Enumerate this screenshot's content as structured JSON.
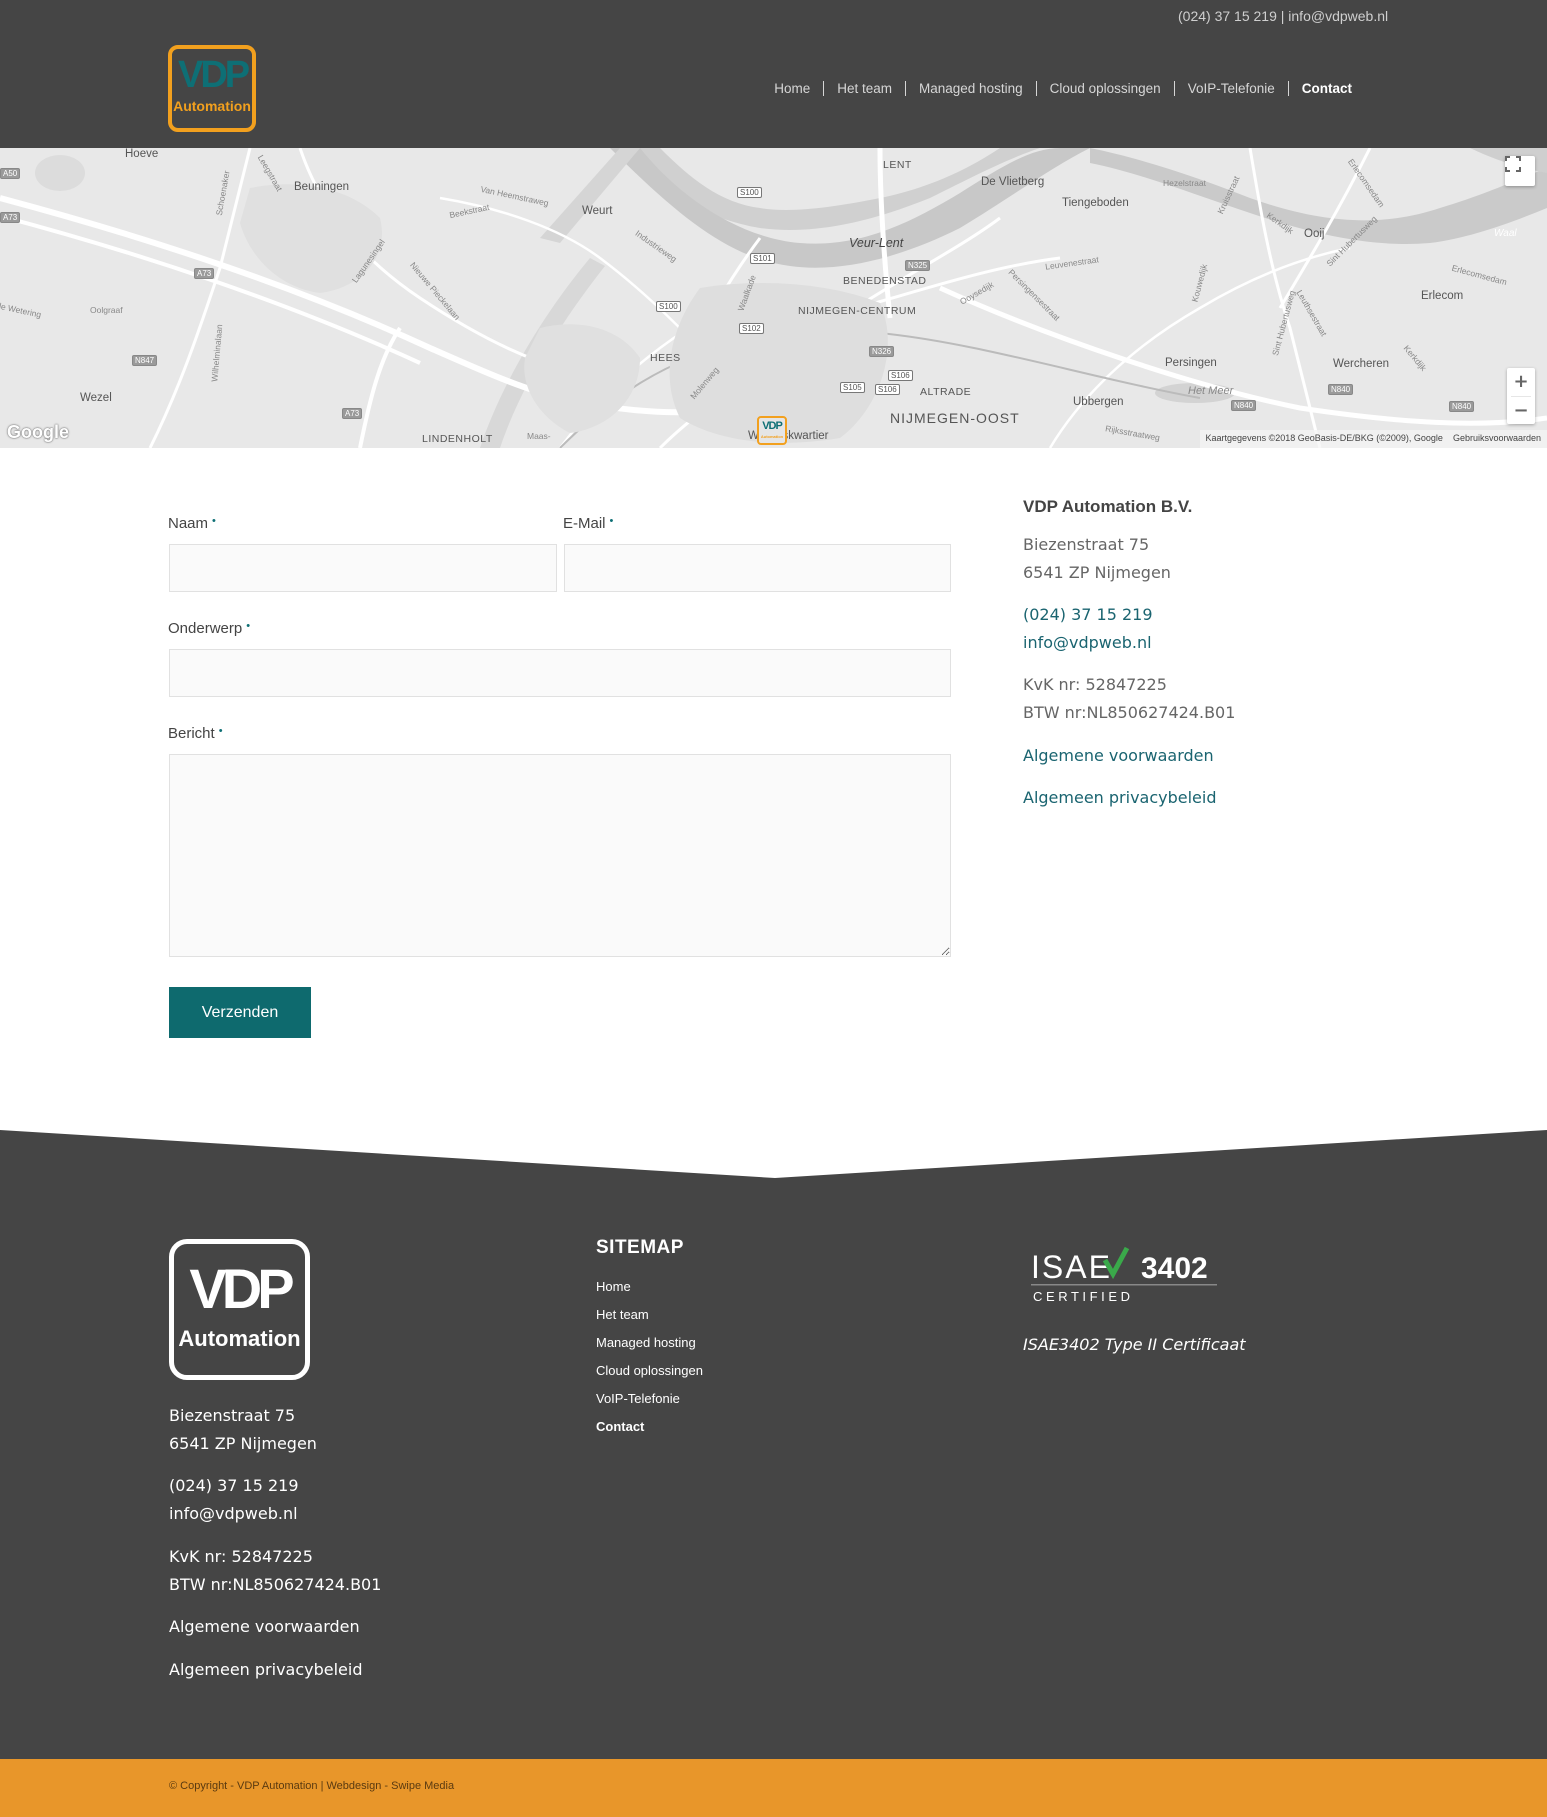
{
  "topbar": {
    "phone": "(024) 37 15 219",
    "separator": "|",
    "email": "info@vdpweb.nl"
  },
  "logo": {
    "mark": "VDP",
    "sub": "Automation"
  },
  "nav": [
    {
      "label": "Home"
    },
    {
      "label": "Het team"
    },
    {
      "label": "Managed hosting"
    },
    {
      "label": "Cloud oplossingen"
    },
    {
      "label": "VoIP-Telefonie"
    },
    {
      "label": "Contact",
      "active": true
    }
  ],
  "map": {
    "places": {
      "hoeve": "Hoeve",
      "beuningen": "Beuningen",
      "weurt": "Weurt",
      "lent": "LENT",
      "de_vlietberg": "De Vlietberg",
      "tiengeboden": "Tiengeboden",
      "ooij": "Ooij",
      "erlecom": "Erlecom",
      "veur_lent": "Veur-Lent",
      "benedenstad": "BENEDENSTAD",
      "nijmegen_centrum": "NIJMEGEN-CENTRUM",
      "hees": "HEES",
      "persingen": "Persingen",
      "wercheren": "Wercheren",
      "ubbergen": "Ubbergen",
      "altrade": "ALTRADE",
      "nijmegen_oost": "NIJMEGEN-OOST",
      "wezel": "Wezel",
      "lindenholt": "LINDENHOLT",
      "willemskwartier": "Willemskwartier",
      "het_meer": "Het Meer"
    },
    "roads": {
      "van_heemstraweg": "Van Heemstraweg",
      "industrieweg": "Industrieweg",
      "nieuwe_pieckelaan": "Nieuwe Pieckelaan",
      "lagunesingel": "Lagunesingel",
      "schoenaker": "Schoenaker",
      "leegstraat": "Leegstraat",
      "wilhelminalaan": "Wilhelminalaan",
      "oolgraaf": "Oolgraaf",
      "molenweg": "Molenweg",
      "waalkade": "Waalkade",
      "hezelstraat": "Hezelstraat",
      "kruisstraat": "Kruisstraat",
      "kerkdijk": "Kerkdijk",
      "sint_hubertusweg": "Sint Hubertusweg",
      "erlecomsedam": "Erlecomsedam",
      "leuthsestraat": "Leuthsestraat",
      "rijksstraatweg": "Rijksstraatweg",
      "oude_wetering": "de Wetering",
      "beekstraat": "Beekstraat",
      "kouwedijk": "Kouwedijk",
      "oosterweg": "Ooysedijk",
      "persingensestraat": "Persingensestraat",
      "leuvenestraat": "Leuvenestraat",
      "kerkdijk2": "Kerkdijk",
      "waal": "Waal",
      "maas_waalkanaal": "Maas-"
    },
    "shields": {
      "a50": "A50",
      "a73a": "A73",
      "a73b": "A73",
      "a73c": "A73",
      "n847": "N847",
      "s100a": "S100",
      "s100b": "S100",
      "s101": "S101",
      "s102": "S102",
      "n325": "N325",
      "n326": "N326",
      "s105": "S105",
      "s106a": "S106",
      "s106b": "S106",
      "n840a": "N840",
      "n840b": "N840",
      "n840c": "N840"
    },
    "google": "Google",
    "attribution": "Kaartgegevens ©2018 GeoBasis-DE/BKG (©2009), Google",
    "terms": "Gebruiksvoorwaarden",
    "zoom_in": "+",
    "zoom_out": "−",
    "pin_mark": "VDP",
    "pin_sub": "Automation"
  },
  "form": {
    "name_label": "Naam",
    "email_label": "E-Mail",
    "subject_label": "Onderwerp",
    "message_label": "Bericht",
    "required_mark": "•",
    "submit_label": "Verzenden",
    "name_value": "",
    "email_value": "",
    "subject_value": "",
    "message_value": ""
  },
  "contact": {
    "company": "VDP Automation B.V.",
    "street": "Biezenstraat 75",
    "city": "6541 ZP Nijmegen",
    "phone": "(024) 37 15 219",
    "email": "info@vdpweb.nl",
    "kvk": "KvK nr: 52847225",
    "btw": "BTW nr:NL850627424.B01",
    "terms": "Algemene voorwaarden",
    "privacy": "Algemeen privacybeleid"
  },
  "footer": {
    "logo_mark": "VDP",
    "logo_sub": "Automation",
    "street": "Biezenstraat 75",
    "city": "6541 ZP Nijmegen",
    "phone": "(024) 37 15 219",
    "email": "info@vdpweb.nl",
    "kvk": "KvK nr: 52847225",
    "btw": "BTW nr:NL850627424.B01",
    "terms": "Algemene voorwaarden",
    "privacy": "Algemeen privacybeleid",
    "sitemap_title": "SITEMAP",
    "sitemap": [
      {
        "label": "Home"
      },
      {
        "label": "Het team"
      },
      {
        "label": "Managed hosting"
      },
      {
        "label": "Cloud oplossingen"
      },
      {
        "label": "VoIP-Telefonie"
      },
      {
        "label": "Contact",
        "active": true
      }
    ],
    "isae_left": "ISAE",
    "isae_right": "3402",
    "isae_certified": "C E R T I F I E D",
    "isae_caption": "ISAE3402 Type II Certificaat",
    "copyright": "© Copyright - VDP Automation | Webdesign - Swipe Media"
  },
  "colors": {
    "header_bg": "#454545",
    "brand_orange": "#f2a01e",
    "brand_teal": "#0e6f75",
    "copyright_bg": "#e8962a"
  }
}
